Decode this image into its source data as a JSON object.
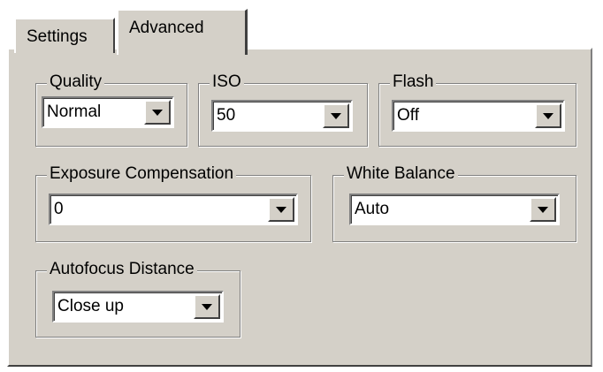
{
  "tabs": [
    {
      "label": "Settings"
    },
    {
      "label": "Advanced"
    }
  ],
  "groups": {
    "quality": {
      "label": "Quality",
      "value": "Normal"
    },
    "iso": {
      "label": "ISO",
      "value": "50"
    },
    "flash": {
      "label": "Flash",
      "value": "Off"
    },
    "exposure": {
      "label": "Exposure Compensation",
      "value": "0"
    },
    "white_balance": {
      "label": "White Balance",
      "value": "Auto"
    },
    "autofocus": {
      "label": "Autofocus Distance",
      "value": "Close up"
    }
  },
  "icons": {
    "dropdown": "chevron-down-icon"
  },
  "colors": {
    "face": "#d4d0c8",
    "shadow": "#808080",
    "highlight": "#ffffff"
  }
}
